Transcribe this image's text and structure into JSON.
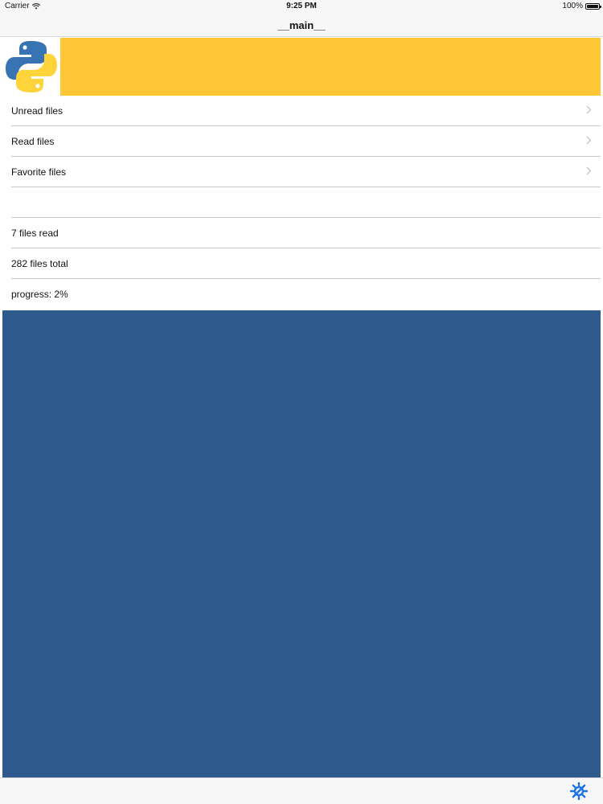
{
  "status_bar": {
    "carrier": "Carrier",
    "time": "9:25 PM",
    "battery": "100%"
  },
  "nav": {
    "title": "__main__"
  },
  "banner": {
    "logo_icon": "python-logo-icon",
    "color": "#ffc736"
  },
  "menu": {
    "items": [
      {
        "label": "Unread files",
        "icon": "chevron-right-icon"
      },
      {
        "label": "Read files",
        "icon": "chevron-right-icon"
      },
      {
        "label": "Favorite files",
        "icon": "chevron-right-icon"
      }
    ]
  },
  "stats": {
    "read": "7 files read",
    "total": "282 files total",
    "progress": "progress: 2%"
  },
  "panel": {
    "color": "#2e5a8e"
  },
  "toolbar": {
    "tool_icon": "wrench-gear-icon",
    "accent": "#1a73e8"
  }
}
